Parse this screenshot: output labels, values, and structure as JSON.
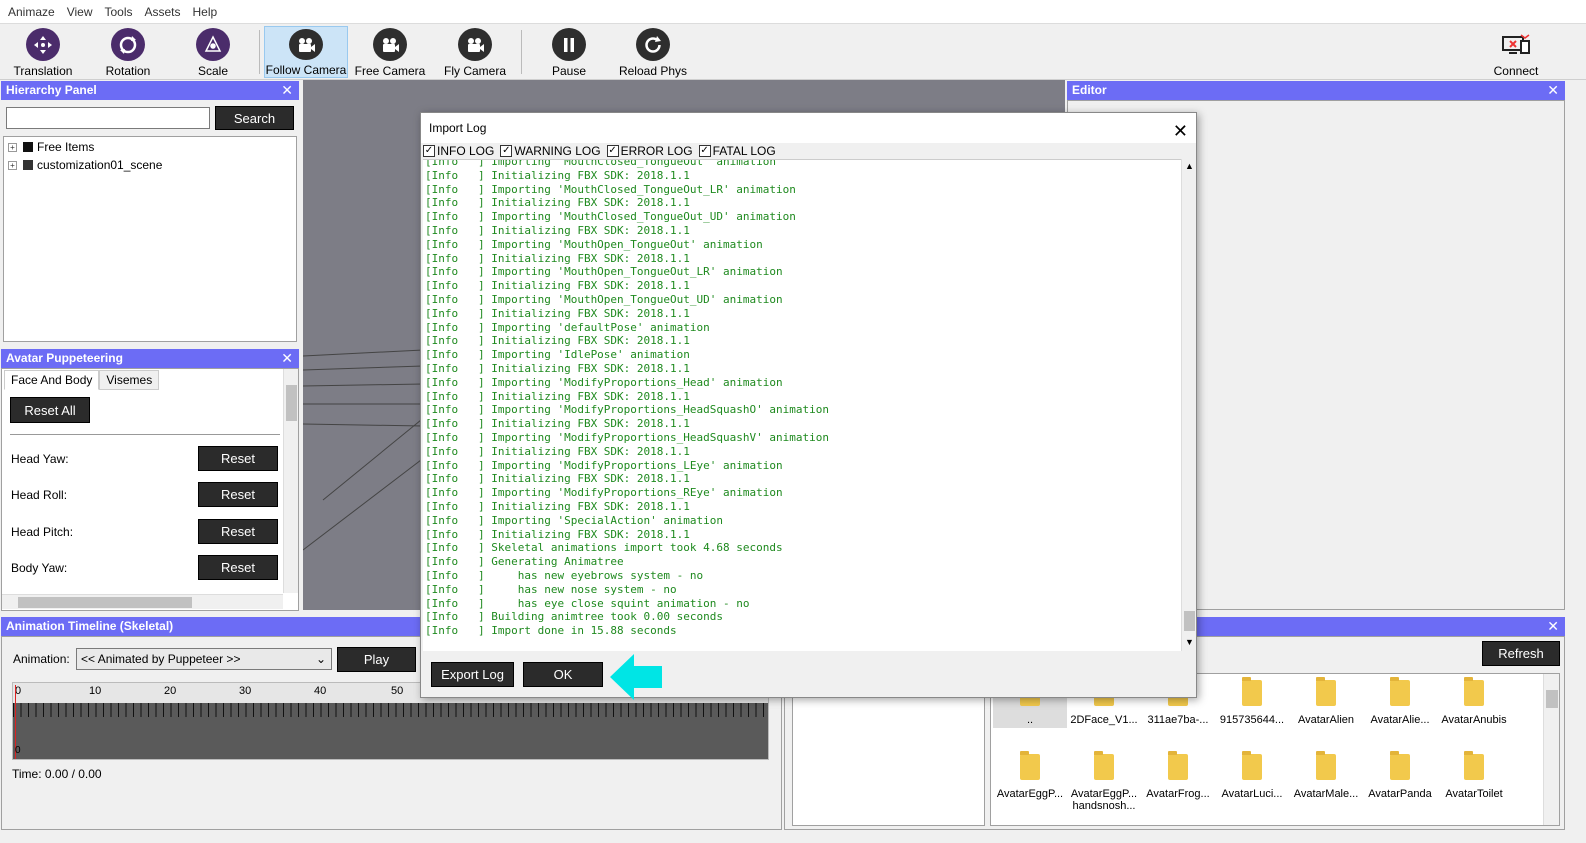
{
  "menu": [
    "Animaze",
    "View",
    "Tools",
    "Assets",
    "Help"
  ],
  "toolbar": {
    "translation": "Translation",
    "rotation": "Rotation",
    "scale": "Scale",
    "follow_camera": "Follow Camera",
    "free_camera": "Free Camera",
    "fly_camera": "Fly Camera",
    "pause": "Pause",
    "reload_phys": "Reload Phys",
    "connect": "Connect"
  },
  "hierarchy": {
    "title": "Hierarchy Panel",
    "close": "✕",
    "search_label": "Search",
    "search_value": "",
    "items": [
      "Free Items",
      "customization01_scene"
    ]
  },
  "editor": {
    "title": "Editor",
    "close": "✕"
  },
  "puppeteering": {
    "title": "Avatar Puppeteering",
    "close": "✕",
    "tabs": [
      "Face And Body",
      "Visemes"
    ],
    "reset_all": "Reset All",
    "rows": [
      {
        "label": "Head Yaw:",
        "button": "Reset"
      },
      {
        "label": "Head Roll:",
        "button": "Reset"
      },
      {
        "label": "Head Pitch:",
        "button": "Reset"
      },
      {
        "label": "Body Yaw:",
        "button": "Reset"
      }
    ]
  },
  "timeline": {
    "title": "Animation Timeline (Skeletal)",
    "animation_label": "Animation:",
    "animation_value": "<< Animated by Puppeteer >>",
    "play": "Play",
    "ticks": [
      "0",
      "10",
      "20",
      "30",
      "40",
      "50"
    ],
    "marker": "0",
    "time": "Time: 0.00 / 0.00"
  },
  "browser": {
    "close": "✕",
    "refresh": "Refresh",
    "folders": [
      "..",
      "2DFace_V1...",
      "311ae7ba-...",
      "915735644...",
      "AvatarAlien",
      "AvatarAlie...",
      "AvatarAnubis",
      "AvatarEggP...",
      "AvatarEggP... handsnosh...",
      "AvatarFrog...",
      "AvatarLuci...",
      "AvatarMale...",
      "AvatarPanda",
      "AvatarToilet"
    ]
  },
  "import_log": {
    "title": "Import Log",
    "close": "✕",
    "filters": [
      "INFO LOG",
      "WARNING LOG",
      "ERROR LOG",
      "FATAL LOG"
    ],
    "lines": [
      "[Info   ] Importing 'MouthClosed_TongueOut' animation",
      "[Info   ] Initializing FBX SDK: 2018.1.1",
      "[Info   ] Importing 'MouthClosed_TongueOut_LR' animation",
      "[Info   ] Initializing FBX SDK: 2018.1.1",
      "[Info   ] Importing 'MouthClosed_TongueOut_UD' animation",
      "[Info   ] Initializing FBX SDK: 2018.1.1",
      "[Info   ] Importing 'MouthOpen_TongueOut' animation",
      "[Info   ] Initializing FBX SDK: 2018.1.1",
      "[Info   ] Importing 'MouthOpen_TongueOut_LR' animation",
      "[Info   ] Initializing FBX SDK: 2018.1.1",
      "[Info   ] Importing 'MouthOpen_TongueOut_UD' animation",
      "[Info   ] Initializing FBX SDK: 2018.1.1",
      "[Info   ] Importing 'defaultPose' animation",
      "[Info   ] Initializing FBX SDK: 2018.1.1",
      "[Info   ] Importing 'IdlePose' animation",
      "[Info   ] Initializing FBX SDK: 2018.1.1",
      "[Info   ] Importing 'ModifyProportions_Head' animation",
      "[Info   ] Initializing FBX SDK: 2018.1.1",
      "[Info   ] Importing 'ModifyProportions_HeadSquashO' animation",
      "[Info   ] Initializing FBX SDK: 2018.1.1",
      "[Info   ] Importing 'ModifyProportions_HeadSquashV' animation",
      "[Info   ] Initializing FBX SDK: 2018.1.1",
      "[Info   ] Importing 'ModifyProportions_LEye' animation",
      "[Info   ] Initializing FBX SDK: 2018.1.1",
      "[Info   ] Importing 'ModifyProportions_REye' animation",
      "[Info   ] Initializing FBX SDK: 2018.1.1",
      "[Info   ] Importing 'SpecialAction' animation",
      "[Info   ] Initializing FBX SDK: 2018.1.1",
      "[Info   ] Skeletal animations import took 4.68 seconds",
      "[Info   ] Generating Animatree",
      "[Info   ]     has new eyebrows system - no",
      "[Info   ]     has new nose system - no",
      "[Info   ]     has eye close squint animation - no",
      "[Info   ] Building animtree took 0.00 seconds",
      "[Info   ] Import done in 15.88 seconds"
    ],
    "export_log": "Export Log",
    "ok": "OK"
  },
  "colors": {
    "panel_header": "#6c6cf5",
    "log_text": "#1f8a1f",
    "highlight_arrow": "#00e5e5"
  }
}
